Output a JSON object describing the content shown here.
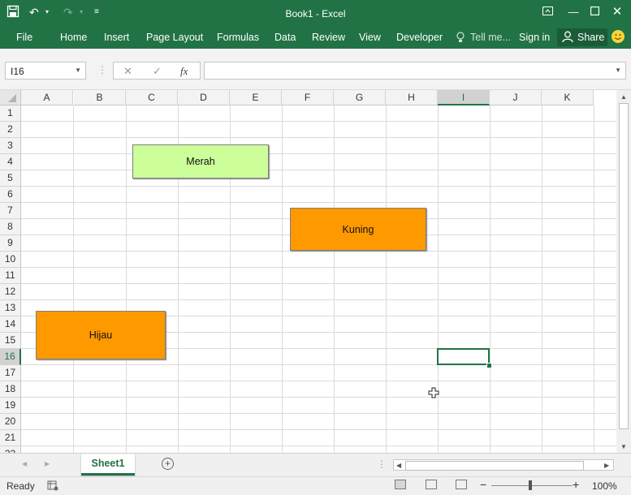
{
  "window": {
    "title": "Book1 - Excel"
  },
  "ribbon": {
    "file": "File",
    "tabs": [
      "Home",
      "Insert",
      "Page Layout",
      "Formulas",
      "Data",
      "Review",
      "View",
      "Developer"
    ],
    "tell_me": "Tell me...",
    "sign_in": "Sign in",
    "share": "Share"
  },
  "formula_bar": {
    "name_box": "I16",
    "fx_label": "fx",
    "formula": ""
  },
  "columns": [
    "A",
    "B",
    "C",
    "D",
    "E",
    "F",
    "G",
    "H",
    "I",
    "J",
    "K"
  ],
  "rows": [
    "1",
    "2",
    "3",
    "4",
    "5",
    "6",
    "7",
    "8",
    "9",
    "10",
    "11",
    "12",
    "13",
    "14",
    "15",
    "16",
    "17",
    "18",
    "19",
    "20",
    "21",
    "22"
  ],
  "selected_cell": {
    "column": "I",
    "row": "16"
  },
  "shapes": [
    {
      "label": "Merah",
      "color": "#ccff99"
    },
    {
      "label": "Kuning",
      "color": "#ff9900"
    },
    {
      "label": "Hijau",
      "color": "#ff9900"
    }
  ],
  "sheet_tabs": [
    "Sheet1"
  ],
  "status": {
    "ready": "Ready",
    "zoom": "100%"
  },
  "colors": {
    "excel_green": "#217346"
  }
}
